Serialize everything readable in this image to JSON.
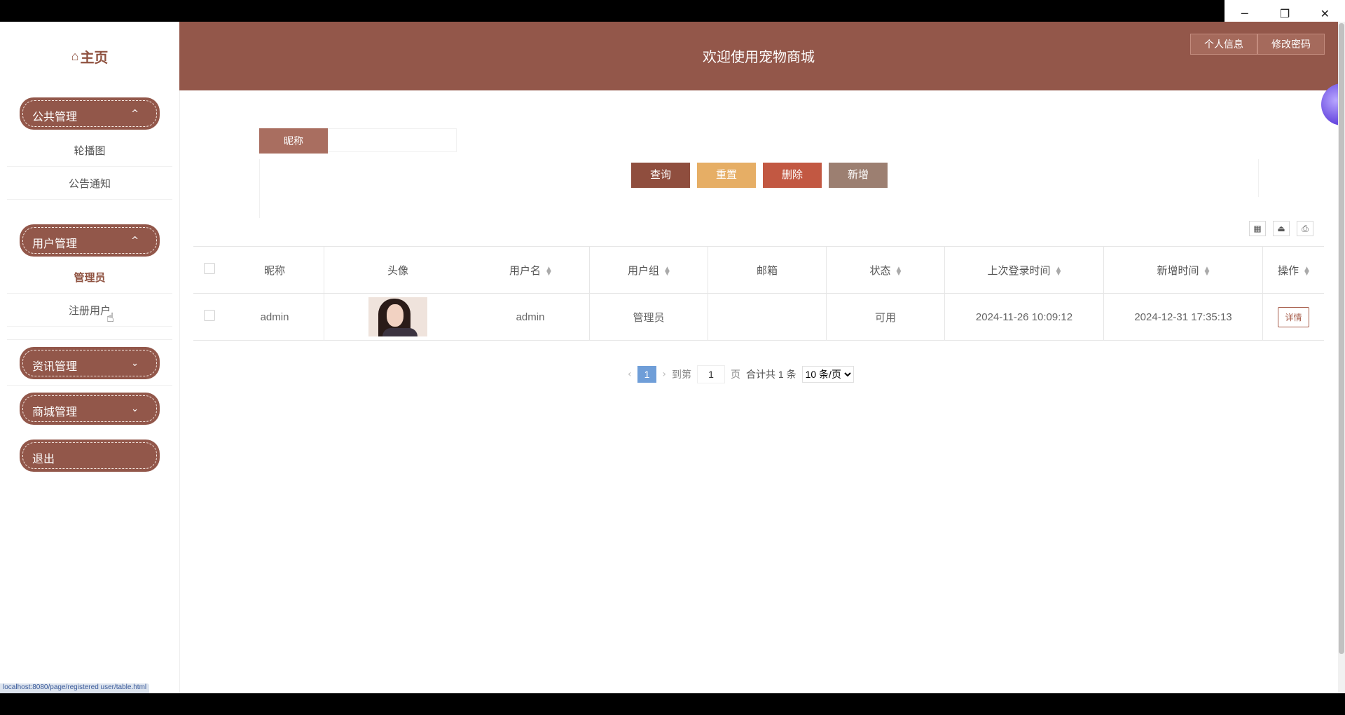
{
  "window": {
    "minimize_icon": "─",
    "restore_icon": "❐",
    "close_icon": "✕"
  },
  "brand": {
    "icon": "⌂",
    "label": "主页"
  },
  "header": {
    "title": "欢迎使用宠物商城",
    "buttons": [
      "个人信息",
      "修改密码"
    ]
  },
  "sidebar": {
    "groups": [
      {
        "label": "公共管理",
        "chevron": "^",
        "items": [
          "轮播图",
          "公告通知"
        ]
      },
      {
        "label": "用户管理",
        "chevron": "^",
        "items": [
          "管理员",
          "注册用户"
        ]
      },
      {
        "label": "资讯管理",
        "chevron": "⌄",
        "items": []
      },
      {
        "label": "商城管理",
        "chevron": "⌄",
        "items": []
      }
    ],
    "logout": "退出",
    "active_item": "管理员"
  },
  "search": {
    "label": "昵称",
    "value": "",
    "placeholder": ""
  },
  "actions": {
    "query": "查询",
    "reset": "重置",
    "delete": "删除",
    "add": "新增"
  },
  "toolbar": {
    "columns_icon": "▦",
    "export_icon": "⏏",
    "print_icon": "⎙"
  },
  "table": {
    "columns": [
      "昵称",
      "头像",
      "用户名",
      "用户组",
      "邮箱",
      "状态",
      "上次登录时间",
      "新增时间",
      "操作"
    ],
    "rows": [
      {
        "nickname": "admin",
        "avatar": "avatar-image",
        "username": "admin",
        "group": "管理员",
        "email": "",
        "status": "可用",
        "last_login": "2024-11-26 10:09:12",
        "created": "2024-12-31 17:35:13",
        "action": "详情"
      }
    ]
  },
  "pagination": {
    "prev": "‹",
    "current": "1",
    "next": "›",
    "goto_label": "到第",
    "goto_value": "1",
    "page_suffix": "页",
    "total": "合计共 1 条",
    "page_size": "10 条/页"
  },
  "status_url": "localhost:8080/page/registered user/table.html"
}
